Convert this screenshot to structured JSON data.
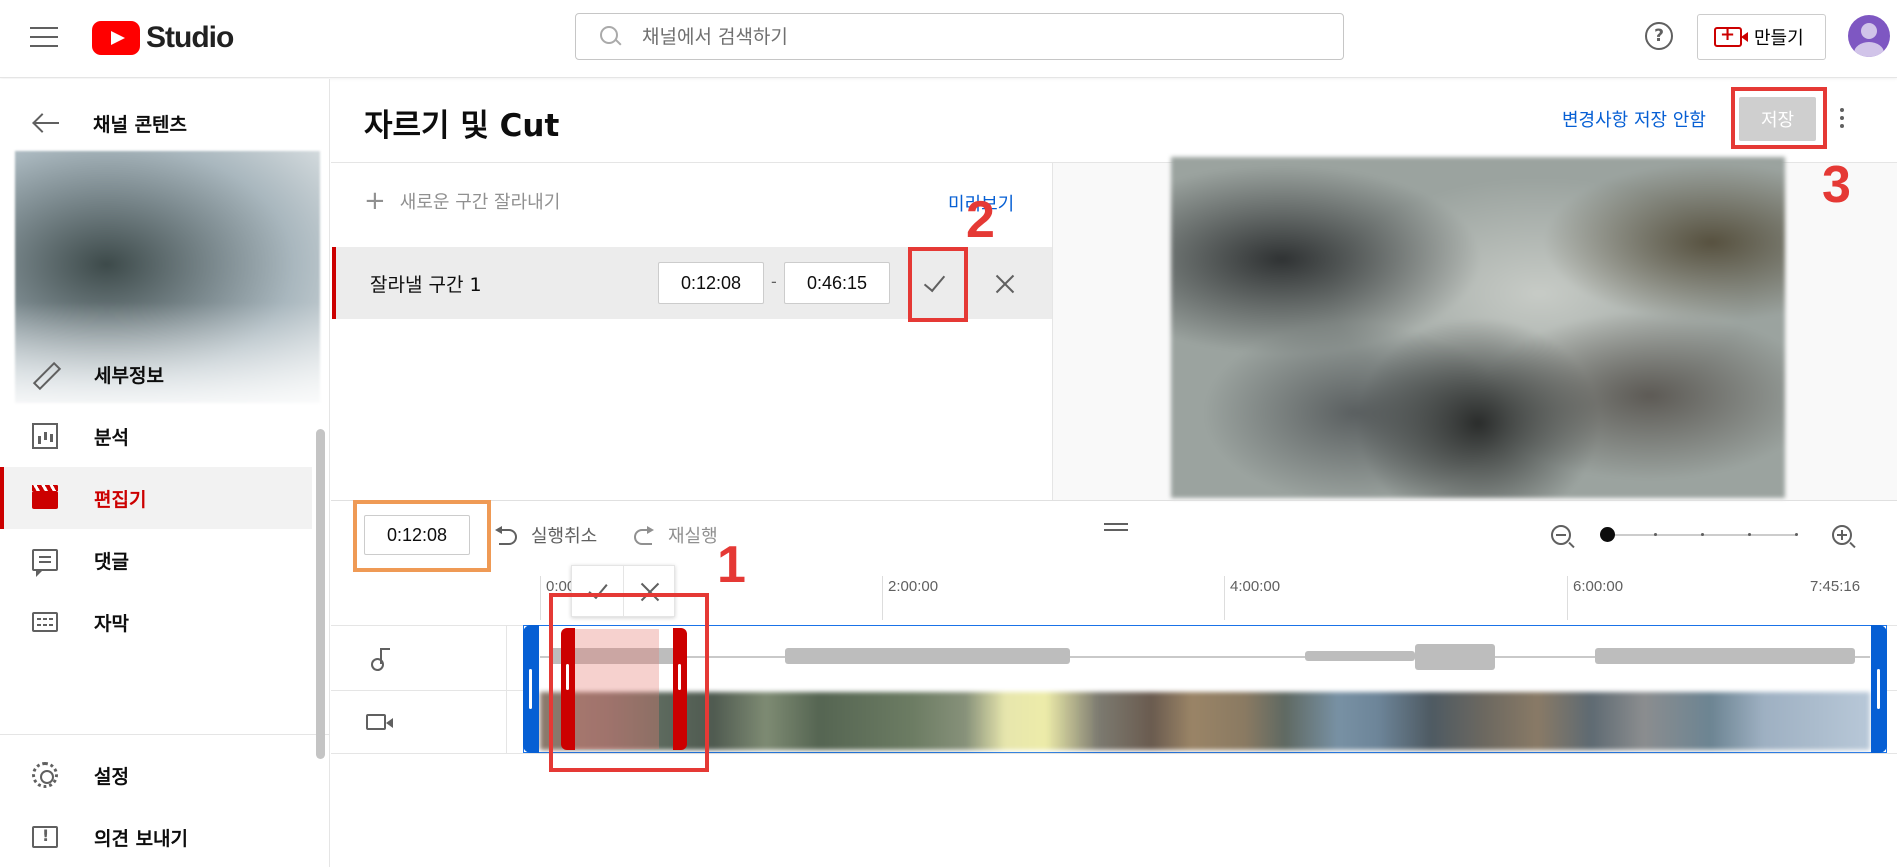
{
  "topbar": {
    "app_name": "Studio",
    "search_placeholder": "채널에서 검색하기",
    "create_label": "만들기"
  },
  "sidebar": {
    "back_label": "채널 콘텐츠",
    "items": [
      {
        "label": "세부정보",
        "icon": "pencil-icon"
      },
      {
        "label": "분석",
        "icon": "analytics-icon"
      },
      {
        "label": "편집기",
        "icon": "editor-icon",
        "active": true
      },
      {
        "label": "댓글",
        "icon": "comments-icon"
      },
      {
        "label": "자막",
        "icon": "subtitles-icon"
      },
      {
        "label": "설정",
        "icon": "settings-icon"
      },
      {
        "label": "의견 보내기",
        "icon": "feedback-icon"
      }
    ]
  },
  "header": {
    "title": "자르기 및 Cut",
    "discard_label": "변경사항 저장 안함",
    "save_label": "저장"
  },
  "cut_panel": {
    "new_cut_label": "새로운 구간 잘라내기",
    "preview_label": "미리보기",
    "segment": {
      "label": "잘라낼 구간 1",
      "start": "0:12:08",
      "end": "0:46:15",
      "separator": "-"
    }
  },
  "timeline": {
    "current_time": "0:12:08",
    "undo_label": "실행취소",
    "redo_label": "재실행",
    "ruler": [
      "0:00",
      "2:00:00",
      "4:00:00",
      "6:00:00",
      "7:45:16"
    ]
  },
  "annotations": [
    "1",
    "2",
    "3"
  ],
  "colors": {
    "accent_red": "#cc0000",
    "link_blue": "#065fd4",
    "annotation_red": "#e53935",
    "annotation_orange": "#ef9a55"
  }
}
